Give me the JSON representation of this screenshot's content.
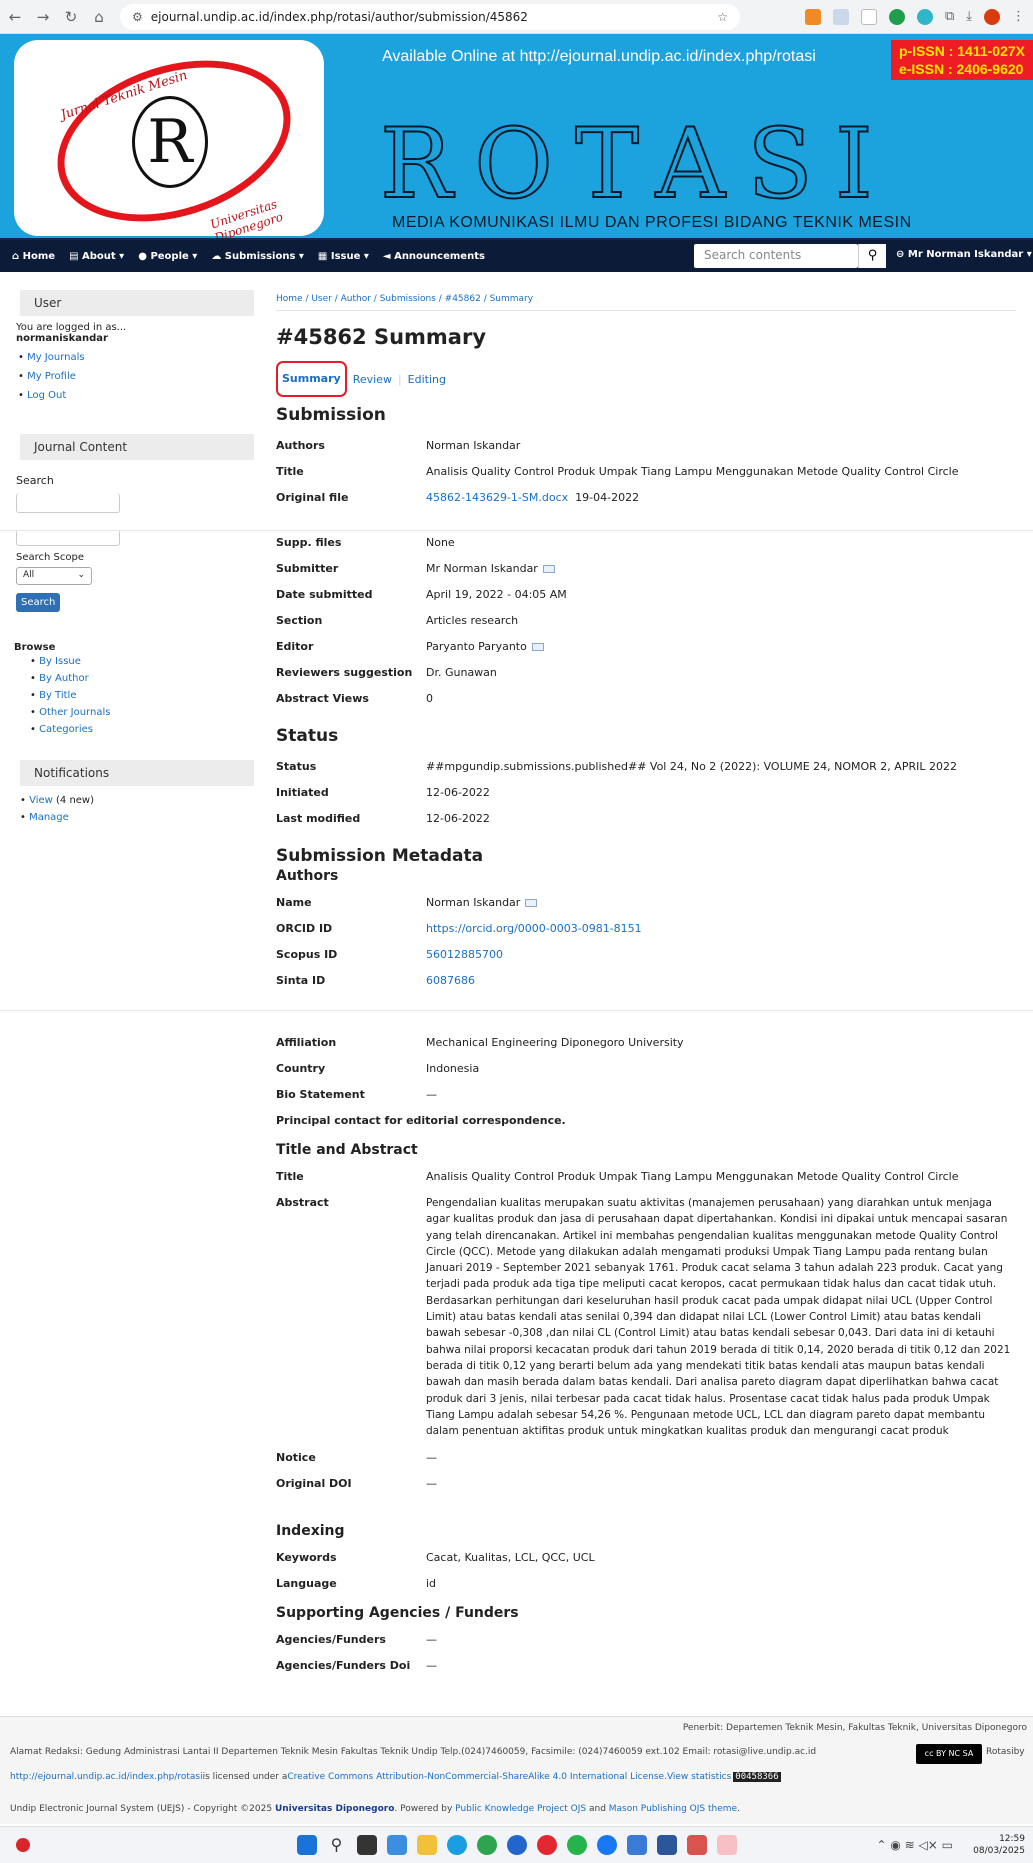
{
  "browser": {
    "url": "ejournal.undip.ac.id/index.php/rotasi/author/submission/45862"
  },
  "banner": {
    "logo_r": "R",
    "logo_top": "Jurnal Teknik Mesin",
    "logo_bottom": "Universitas Diponegoro",
    "available": "Available Online at http://ejournal.undip.ac.id/index.php/rotasi",
    "pissn": "p-ISSN : 1411-027X",
    "eissn": "e-ISSN : 2406-9620",
    "name": "ROTASI",
    "tagline": "MEDIA KOMUNIKASI ILMU DAN PROFESI BIDANG TEKNIK MESIN"
  },
  "nav": {
    "home": "Home",
    "about": "About",
    "people": "People",
    "submissions": "Submissions",
    "issue": "Issue",
    "announcements": "Announcements",
    "search_placeholder": "Search contents",
    "user": "Mr Norman Iskandar"
  },
  "sidebar": {
    "user_title": "User",
    "logged_as": "You are logged in as...",
    "username": "normaniskandar",
    "links": [
      "My Journals",
      "My Profile",
      "Log Out"
    ],
    "journal_content": "Journal Content",
    "search_label": "Search",
    "scope_label": "Search Scope",
    "scope_value": "All",
    "search_btn": "Search",
    "browse": "Browse",
    "browse_links": [
      "By Issue",
      "By Author",
      "By Title",
      "Other Journals",
      "Categories"
    ],
    "notifications": "Notifications",
    "view": "View",
    "view_count": "(4 new)",
    "manage": "Manage"
  },
  "breadcrumb": [
    "Home",
    "User",
    "Author",
    "Submissions",
    "#45862",
    "Summary"
  ],
  "page_title": "#45862 Summary",
  "tabs": [
    "Summary",
    "Review",
    "Editing"
  ],
  "submission": {
    "heading": "Submission",
    "authors_k": "Authors",
    "authors_v": "Norman Iskandar",
    "title_k": "Title",
    "title_v": "Analisis Quality Control Produk Umpak Tiang Lampu Menggunakan Metode Quality Control Circle",
    "file_k": "Original file",
    "file_v": "45862-143629-1-SM.docx",
    "file_date": "19-04-2022",
    "supp_k": "Supp. files",
    "supp_v": "None",
    "submitter_k": "Submitter",
    "submitter_v": "Mr Norman Iskandar",
    "date_k": "Date submitted",
    "date_v": "April 19, 2022 - 04:05 AM",
    "section_k": "Section",
    "section_v": "Articles research",
    "editor_k": "Editor",
    "editor_v": "Paryanto Paryanto",
    "reviewers_k": "Reviewers suggestion",
    "reviewers_v": "Dr. Gunawan",
    "views_k": "Abstract Views",
    "views_v": "0"
  },
  "status": {
    "heading": "Status",
    "status_k": "Status",
    "status_v": "##mpgundip.submissions.published##   Vol 24, No 2 (2022): VOLUME 24, NOMOR 2, APRIL 2022",
    "initiated_k": "Initiated",
    "initiated_v": "12-06-2022",
    "modified_k": "Last modified",
    "modified_v": "12-06-2022"
  },
  "metadata": {
    "heading": "Submission Metadata",
    "authors_heading": "Authors",
    "name_k": "Name",
    "name_v": "Norman Iskandar",
    "orcid_k": "ORCID ID",
    "orcid_v": "https://orcid.org/0000-0003-0981-8151",
    "scopus_k": "Scopus ID",
    "scopus_v": "56012885700",
    "sinta_k": "Sinta ID",
    "sinta_v": "6087686",
    "aff_k": "Affiliation",
    "aff_v": "Mechanical Engineering Diponegoro University",
    "country_k": "Country",
    "country_v": "Indonesia",
    "bio_k": "Bio Statement",
    "bio_v": "—",
    "principal": "Principal contact for editorial correspondence."
  },
  "title_abstract": {
    "heading": "Title and Abstract",
    "title_k": "Title",
    "title_v": "Analisis Quality Control Produk Umpak Tiang Lampu Menggunakan Metode Quality Control Circle",
    "abstract_k": "Abstract",
    "abstract_v": "Pengendalian kualitas merupakan suatu aktivitas (manajemen perusahaan) yang diarahkan untuk menjaga agar kualitas produk dan jasa di perusahaan dapat dipertahankan. Kondisi ini dipakai untuk mencapai sasaran yang telah direncanakan. Artikel ini membahas pengendalian kualitas menggunakan metode Quality Control Circle (QCC). Metode yang dilakukan adalah mengamati produksi Umpak Tiang Lampu pada rentang bulan Januari 2019 - September 2021 sebanyak 1761. Produk cacat selama 3 tahun adalah 223 produk. Cacat yang terjadi pada produk ada tiga tipe meliputi cacat keropos, cacat permukaan tidak halus dan cacat tidak utuh. Berdasarkan perhitungan dari keseluruhan hasil produk cacat pada umpak didapat nilai UCL (Upper Control Limit) atau batas kendali atas senilai 0,394 dan didapat nilai LCL (Lower Control Limit) atau batas kendali bawah sebesar -0,308 ,dan nilai CL (Control Limit) atau batas kendali sebesar 0,043. Dari data ini di ketauhi bahwa nilai proporsi kecacatan produk dari tahun 2019 berada di titik 0,14, 2020 berada di titik 0,12 dan 2021 berada di titik 0,12 yang berarti belum ada yang mendekati titik batas kendali atas maupun batas kendali bawah dan masih berada dalam batas kendali. Dari analisa pareto diagram dapat diperlihatkan bahwa cacat produk dari 3 jenis, nilai terbesar pada cacat tidak halus. Prosentase cacat tidak halus pada produk Umpak Tiang Lampu adalah sebesar 54,26 %. Pengunaan metode UCL, LCL dan diagram pareto dapat membantu dalam penentuan aktifitas produk untuk mingkatkan kualitas produk dan mengurangi cacat produk",
    "notice_k": "Notice",
    "notice_v": "—",
    "doi_k": "Original DOI",
    "doi_v": "—"
  },
  "indexing": {
    "heading": "Indexing",
    "keywords_k": "Keywords",
    "keywords_v": "Cacat, Kualitas, LCL, QCC, UCL",
    "language_k": "Language",
    "language_v": "id"
  },
  "funders": {
    "heading": "Supporting Agencies / Funders",
    "agencies_k": "Agencies/Funders",
    "agencies_v": "—",
    "doi_k": "Agencies/Funders Doi",
    "doi_v": "—"
  },
  "footer": {
    "publisher": "Penerbit: Departemen Teknik Mesin, Fakultas Teknik, Universitas Diponegoro",
    "address": "Alamat Redaksi: Gedung Administrasi Lantai II Departemen Teknik Mesin Fakultas Teknik Undip Telp.(024)7460059, Facsimile: (024)7460059 ext.102 Email: rotasi@live.undip.ac.id",
    "rotasiby": "Rotasiby",
    "cc_badge": "cc BY NC SA",
    "link1": "http://ejournal.undip.ac.id/index.php/rotasi",
    "licensed": "is licensed under a",
    "cc_link": "Creative Commons Attribution-NonCommercial-ShareAlike 4.0 International License.",
    "view_stats": "View statistics",
    "counter": "00458366",
    "copyright": "Undip Electronic Journal System (UEJS) - Copyright ©2025 ",
    "univ": "Universitas Diponegoro",
    "powered": ". Powered by ",
    "pkp": "Public Knowledge Project OJS",
    "and": " and ",
    "mason": "Mason Publishing OJS theme",
    "dot": "."
  },
  "taskbar": {
    "time": "12:59",
    "date": "08/03/2025"
  }
}
